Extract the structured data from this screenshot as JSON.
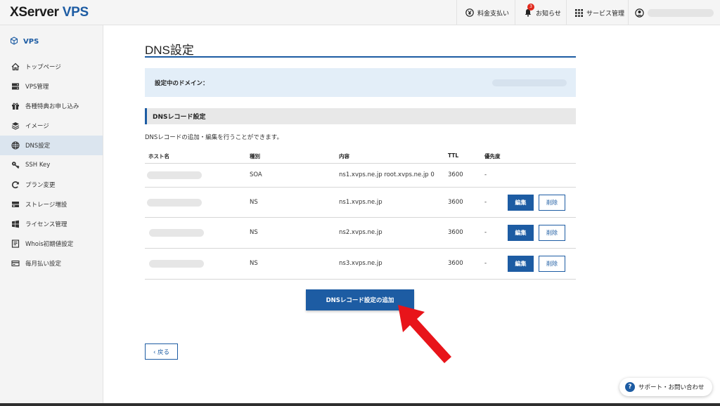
{
  "header": {
    "logo_main": "XServer",
    "logo_sub": "VPS",
    "payment_label": "料金支払い",
    "notice_label": "お知らせ",
    "notice_count": "3",
    "service_label": "サービス管理"
  },
  "sidebar": {
    "title": "VPS",
    "items": [
      {
        "label": "トップページ",
        "icon": "home-icon"
      },
      {
        "label": "VPS管理",
        "icon": "server-icon"
      },
      {
        "label": "各種特典お申し込み",
        "icon": "gift-icon"
      },
      {
        "label": "イメージ",
        "icon": "layers-icon"
      },
      {
        "label": "DNS設定",
        "icon": "globe-icon"
      },
      {
        "label": "SSH Key",
        "icon": "key-icon"
      },
      {
        "label": "プラン変更",
        "icon": "refresh-icon"
      },
      {
        "label": "ストレージ増設",
        "icon": "storage-icon"
      },
      {
        "label": "ライセンス管理",
        "icon": "windows-icon"
      },
      {
        "label": "Whois初期値設定",
        "icon": "id-card-icon"
      },
      {
        "label": "毎月払い設定",
        "icon": "card-icon"
      }
    ],
    "active_index": 4
  },
  "main": {
    "title": "DNS設定",
    "domain_label": "設定中のドメイン：",
    "section_title": "DNSレコード設定",
    "description": "DNSレコードの追加・編集を行うことができます。",
    "columns": [
      "ホスト名",
      "種別",
      "内容",
      "TTL",
      "優先度"
    ],
    "rows": [
      {
        "type": "SOA",
        "content": "ns1.xvps.ne.jp root.xvps.ne.jp 0",
        "ttl": "3600",
        "priority": "-"
      },
      {
        "type": "NS",
        "content": "ns1.xvps.ne.jp",
        "ttl": "3600",
        "priority": "-"
      },
      {
        "type": "NS",
        "content": "ns2.xvps.ne.jp",
        "ttl": "3600",
        "priority": "-"
      },
      {
        "type": "NS",
        "content": "ns3.xvps.ne.jp",
        "ttl": "3600",
        "priority": "-"
      }
    ],
    "edit_label": "編集",
    "delete_label": "削除",
    "add_button": "DNSレコード設定の追加",
    "back_button": "‹ 戻る"
  },
  "support": {
    "label": "サポート・お問い合わせ",
    "icon_text": "?"
  },
  "colors": {
    "accent": "#1d5ca3",
    "arrow": "#e8141a",
    "badge": "#e0281c"
  }
}
